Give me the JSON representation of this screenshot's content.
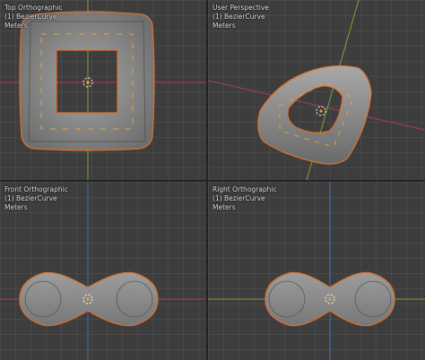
{
  "viewports": {
    "top": {
      "view_name": "Top Orthographic",
      "object": "(1) BezierCurve",
      "units": "Meters"
    },
    "user": {
      "view_name": "User Perspective",
      "object": "(1) BezierCurve",
      "units": "Meters"
    },
    "front": {
      "view_name": "Front Orthographic",
      "object": "(1) BezierCurve",
      "units": "Meters"
    },
    "right": {
      "view_name": "Right Orthographic",
      "object": "(1) BezierCurve",
      "units": "Meters"
    }
  },
  "colors": {
    "background": "#3d3d3d",
    "x_axis": "#a8404c",
    "y_axis": "#7ea33a",
    "z_axis": "#3c6fb0",
    "selection_outline": "#e0702a",
    "mesh_fill": "#8a8a8a"
  },
  "icons": [
    "3d-cursor-icon"
  ]
}
